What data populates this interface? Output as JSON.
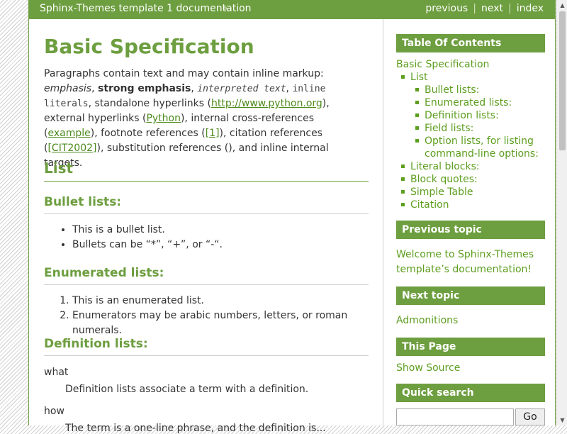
{
  "topbar": {
    "brand": "Sphinx-Themes template 1 documentation",
    "raquo": "»",
    "previous": "previous",
    "next": "next",
    "index": "index",
    "separator": "|"
  },
  "main": {
    "title": "Basic Specification",
    "intro": {
      "p1": "Paragraphs contain text and may contain inline markup: ",
      "emphasis": "emphasis",
      "comma": ", ",
      "strong": "strong emphasis",
      "comma2": ", ",
      "interpreted": "interpreted text",
      "comma3": ", ",
      "literals": "inline literals",
      "p2": ", standalone hyperlinks (",
      "link1": "http://www.python.org",
      "p3": "), external hyperlinks (",
      "link2": "Python",
      "p4": "), internal cross-references (",
      "link3": "example",
      "p5": "), footnote references (",
      "link4": "[1]",
      "p6": "), citation references (",
      "link5": "[CIT2002]",
      "p7": "), substitution references (), and inline internal targets."
    },
    "list_heading": "List",
    "bullet_heading": "Bullet lists:",
    "bullets": [
      "This is a bullet list.",
      "Bullets can be “*”, “+”, or “-“."
    ],
    "enum_heading": "Enumerated lists:",
    "enums": [
      "This is an enumerated list.",
      "Enumerators may be arabic numbers, letters, or roman numerals."
    ],
    "def_heading": "Definition lists:",
    "defs": [
      {
        "term": "what",
        "definition": "Definition lists associate a term with a definition."
      },
      {
        "term": "how",
        "definition": "The term is a one-line phrase, and the definition is..."
      }
    ]
  },
  "sidebar": {
    "toc_title": "Table Of Contents",
    "toc_root": "Basic Specification",
    "toc_list": "List",
    "toc_sub": [
      "Bullet lists:",
      "Enumerated lists:",
      "Definition lists:",
      "Field lists:",
      "Option lists, for listing",
      "command-line options:"
    ],
    "toc_items": [
      "Literal blocks:",
      "Block quotes:",
      "Simple Table",
      "Citation"
    ],
    "prev_title": "Previous topic",
    "prev_link_line1": "Welcome to Sphinx-Themes",
    "prev_link_line2": "template’s documentation!",
    "next_title": "Next topic",
    "next_link": "Admonitions",
    "this_page_title": "This Page",
    "show_source": "Show Source",
    "search_title": "Quick search",
    "search_button": "Go"
  }
}
